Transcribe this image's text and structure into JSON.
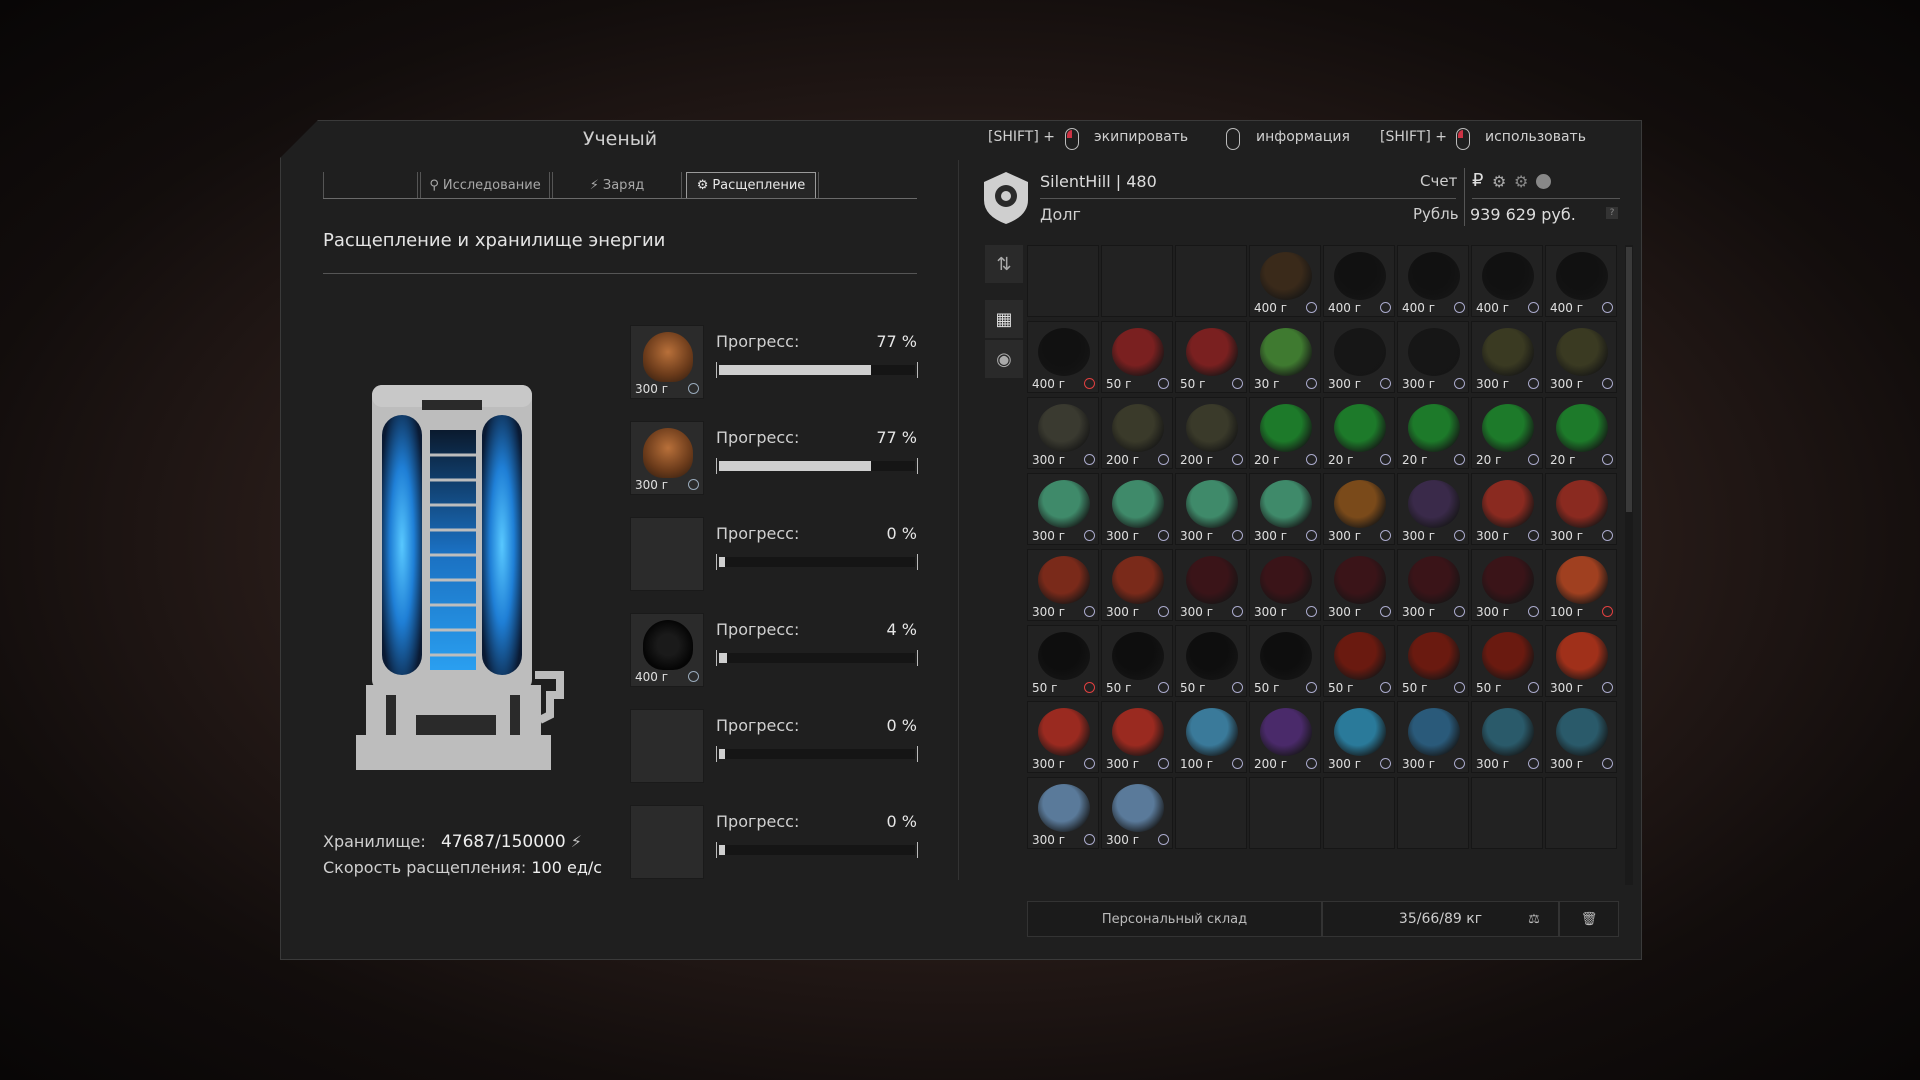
{
  "window": {
    "title": "Ученый"
  },
  "tabs": [
    {
      "label": "",
      "icon": "none"
    },
    {
      "label": "Исследование",
      "icon": "search-icon"
    },
    {
      "label": "Заряд",
      "icon": "lightning-icon"
    },
    {
      "label": "Расщепление",
      "icon": "gear-icon",
      "active": true
    },
    {
      "label": "",
      "icon": "none"
    }
  ],
  "section_title": "Расщепление и хранилище энергии",
  "progress_label": "Прогресс:",
  "slots": [
    {
      "weight": "300 г",
      "progress": "77 %",
      "progress_value": 0.77,
      "item": "artifact-brown"
    },
    {
      "weight": "300 г",
      "progress": "77 %",
      "progress_value": 0.77,
      "item": "artifact-brown"
    },
    {
      "weight": "",
      "progress": "0 %",
      "progress_value": 0,
      "item": "empty"
    },
    {
      "weight": "400 г",
      "progress": "4 %",
      "progress_value": 0.04,
      "item": "artifact-urchin"
    },
    {
      "weight": "",
      "progress": "0 %",
      "progress_value": 0,
      "item": "empty"
    },
    {
      "weight": "",
      "progress": "0 %",
      "progress_value": 0,
      "item": "empty"
    }
  ],
  "storage": {
    "label": "Хранилище:",
    "value": "47687/150000",
    "speed_label": "Скорость расщепления:",
    "speed_value": "100 ед/с"
  },
  "hints": {
    "equip_key": "[SHIFT] +",
    "equip": "экипировать",
    "info": "информация",
    "use_key": "[SHIFT] +",
    "use": "использовать"
  },
  "player": {
    "name": "SilentHill | 480",
    "debt_label": "Долг",
    "account_label": "Счет",
    "currency_label": "Рубль",
    "balance": "939 629 руб.",
    "help": "?"
  },
  "inventory": {
    "rows": [
      [
        {
          "w": "",
          "c": ""
        },
        {
          "w": "",
          "c": ""
        },
        {
          "w": "",
          "c": ""
        },
        {
          "w": "400 г",
          "c": "#3a2a1a"
        },
        {
          "w": "400 г",
          "c": "#111"
        },
        {
          "w": "400 г",
          "c": "#111"
        },
        {
          "w": "400 г",
          "c": "#111"
        },
        {
          "w": "400 г",
          "c": "#111"
        }
      ],
      [
        {
          "w": "400 г",
          "c": "#111",
          "red": true
        },
        {
          "w": "50 г",
          "c": "#7a2020"
        },
        {
          "w": "50 г",
          "c": "#7a2020"
        },
        {
          "w": "30 г",
          "c": "#3f7a30"
        },
        {
          "w": "300 г",
          "c": "#161616"
        },
        {
          "w": "300 г",
          "c": "#161616"
        },
        {
          "w": "300 г",
          "c": "#3a3a22"
        },
        {
          "w": "300 г",
          "c": "#3a3a22"
        }
      ],
      [
        {
          "w": "300 г",
          "c": "#3a3a30"
        },
        {
          "w": "200 г",
          "c": "#3a3a2a"
        },
        {
          "w": "200 г",
          "c": "#3a3a2a"
        },
        {
          "w": "20 г",
          "c": "#1d7a2a"
        },
        {
          "w": "20 г",
          "c": "#1d7a2a"
        },
        {
          "w": "20 г",
          "c": "#1d7a2a"
        },
        {
          "w": "20 г",
          "c": "#1d7a2a"
        },
        {
          "w": "20 г",
          "c": "#1d7a2a"
        }
      ],
      [
        {
          "w": "300 г",
          "c": "#3f8a6a"
        },
        {
          "w": "300 г",
          "c": "#3f8a6a"
        },
        {
          "w": "300 г",
          "c": "#3f8a6a"
        },
        {
          "w": "300 г",
          "c": "#3f8a6a"
        },
        {
          "w": "300 г",
          "c": "#7a4a1a"
        },
        {
          "w": "300 г",
          "c": "#3a2a4a"
        },
        {
          "w": "300 г",
          "c": "#8a2a20"
        },
        {
          "w": "300 г",
          "c": "#8a2a20"
        }
      ],
      [
        {
          "w": "300 г",
          "c": "#7a2a1a"
        },
        {
          "w": "300 г",
          "c": "#7a2a1a"
        },
        {
          "w": "300 г",
          "c": "#3a1418"
        },
        {
          "w": "300 г",
          "c": "#3a1418"
        },
        {
          "w": "300 г",
          "c": "#3a1418"
        },
        {
          "w": "300 г",
          "c": "#3a1418"
        },
        {
          "w": "300 г",
          "c": "#3a1418"
        },
        {
          "w": "100 г",
          "c": "#a04020",
          "red": true
        }
      ],
      [
        {
          "w": "50 г",
          "c": "#0e0e0e",
          "red": true
        },
        {
          "w": "50 г",
          "c": "#0e0e0e"
        },
        {
          "w": "50 г",
          "c": "#0e0e0e"
        },
        {
          "w": "50 г",
          "c": "#0e0e0e"
        },
        {
          "w": "50 г",
          "c": "#6a1a10"
        },
        {
          "w": "50 г",
          "c": "#6a1a10"
        },
        {
          "w": "50 г",
          "c": "#6a1a10"
        },
        {
          "w": "300 г",
          "c": "#a0301a"
        }
      ],
      [
        {
          "w": "300 г",
          "c": "#9a2a20"
        },
        {
          "w": "300 г",
          "c": "#9a2a20"
        },
        {
          "w": "100 г",
          "c": "#3a7a9a"
        },
        {
          "w": "200 г",
          "c": "#4a2a6a"
        },
        {
          "w": "300 г",
          "c": "#2a7a9a"
        },
        {
          "w": "300 г",
          "c": "#2a5a7a"
        },
        {
          "w": "300 г",
          "c": "#2a5a6a"
        },
        {
          "w": "300 г",
          "c": "#2a5a6a"
        }
      ],
      [
        {
          "w": "300 г",
          "c": "#5a7a9a"
        },
        {
          "w": "300 г",
          "c": "#5a7a9a"
        },
        {
          "w": "",
          "c": ""
        },
        {
          "w": "",
          "c": ""
        },
        {
          "w": "",
          "c": ""
        },
        {
          "w": "",
          "c": ""
        },
        {
          "w": "",
          "c": ""
        },
        {
          "w": "",
          "c": ""
        }
      ]
    ]
  },
  "footer": {
    "stash": "Персональный склад",
    "weight": "35/66/89 кг"
  },
  "colors": {
    "panel": "#1f1f1f",
    "reactor_glow": "#29a8ff",
    "accent_red": "#e04040"
  }
}
